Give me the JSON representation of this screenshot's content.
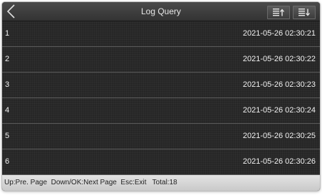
{
  "header": {
    "title": "Log Query",
    "back_icon": "chevron-left-icon",
    "sort_asc_icon": "sort-ascending-icon",
    "sort_desc_icon": "sort-descending-icon"
  },
  "rows": [
    {
      "index": "1",
      "time": "2021-05-26 02:30:21"
    },
    {
      "index": "2",
      "time": "2021-05-26 02:30:22"
    },
    {
      "index": "3",
      "time": "2021-05-26 02:30:23"
    },
    {
      "index": "4",
      "time": "2021-05-26 02:30:24"
    },
    {
      "index": "5",
      "time": "2021-05-26 02:30:25"
    },
    {
      "index": "6",
      "time": "2021-05-26 02:30:26"
    }
  ],
  "footer": {
    "hint": "Up:Pre. Page  Down/OK:Next Page  Esc:Exit   Total:18"
  },
  "colors": {
    "background": "#262626",
    "header": "#3a3a3a",
    "footer": "#d6d6d6",
    "text": "#f2f2f2"
  }
}
